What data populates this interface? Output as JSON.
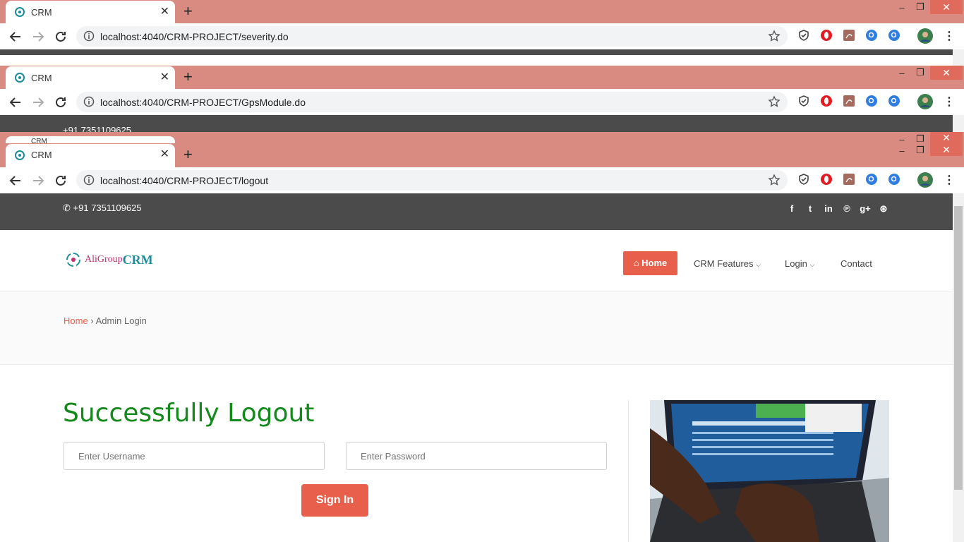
{
  "windows": [
    {
      "tab_title": "CRM",
      "url": "localhost:4040/CRM-PROJECT/severity.do"
    },
    {
      "tab_title": "CRM",
      "url": "localhost:4040/CRM-PROJECT/GpsModule.do"
    },
    {
      "tab_title": "CRM",
      "url": "localhost:4040/CRM-PROJECT/logout"
    }
  ],
  "hidden_tab_title": "CRM",
  "browser_colors": {
    "tabbar": "#d98b81",
    "close": "#e06b5c"
  },
  "page": {
    "phone": "+91 7351109625",
    "social_icons": [
      "facebook-icon",
      "twitter-icon",
      "linkedin-icon",
      "pinterest-icon",
      "google-plus-icon",
      "dribbble-icon"
    ],
    "logo": {
      "part1": "AliGroup",
      "part2": "CRM"
    },
    "nav": {
      "home": "Home",
      "crm_features": "CRM Features",
      "login": "Login",
      "contact": "Contact"
    },
    "breadcrumb": {
      "home": "Home",
      "separator": "›",
      "current": "Admin Login"
    },
    "heading": "Successfully Logout",
    "username_placeholder": "Enter Username",
    "password_placeholder": "Enter Password",
    "signin": "Sign In",
    "accent": "#e8604c",
    "heading_color": "#138a1b"
  }
}
